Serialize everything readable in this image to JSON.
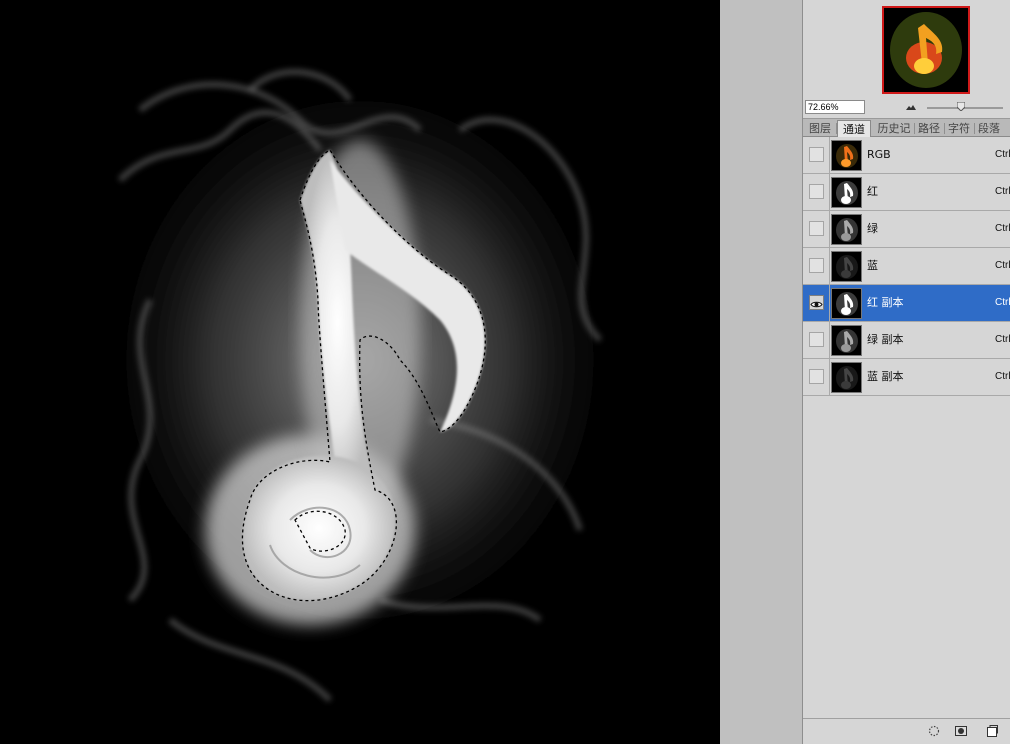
{
  "navigator": {
    "zoom_value": "72.66%",
    "zoom_slider_level": 0.45
  },
  "tabs": [
    {
      "label": "图层",
      "active": false
    },
    {
      "label": "通道",
      "active": true
    },
    {
      "label": "历史记",
      "active": false
    },
    {
      "label": "路径",
      "active": false
    },
    {
      "label": "字符",
      "active": false
    },
    {
      "label": "段落",
      "active": false
    }
  ],
  "channels": [
    {
      "name": "RGB",
      "shortcut": "Ctrl",
      "visible": false,
      "selected": false,
      "thumb": "color"
    },
    {
      "name": "红",
      "shortcut": "Ctrl",
      "visible": false,
      "selected": false,
      "thumb": "bright"
    },
    {
      "name": "绿",
      "shortcut": "Ctrl",
      "visible": false,
      "selected": false,
      "thumb": "mid"
    },
    {
      "name": "蓝",
      "shortcut": "Ctrl",
      "visible": false,
      "selected": false,
      "thumb": "dark"
    },
    {
      "name": "红 副本",
      "shortcut": "Ctrl",
      "visible": true,
      "selected": true,
      "thumb": "bright"
    },
    {
      "name": "绿 副本",
      "shortcut": "Ctrl",
      "visible": false,
      "selected": false,
      "thumb": "mid"
    },
    {
      "name": "蓝 副本",
      "shortcut": "Ctrl",
      "visible": false,
      "selected": false,
      "thumb": "dark"
    }
  ],
  "colors": {
    "selection": "#2f6cc7",
    "thumb_border": "#d01a1a"
  },
  "icons": {
    "eye": "eye-icon",
    "zoom_out": "zoom-out-mountain-icon",
    "load_selection": "dotted-circle-icon",
    "save_selection": "mask-icon",
    "new_channel": "new-page-icon"
  }
}
